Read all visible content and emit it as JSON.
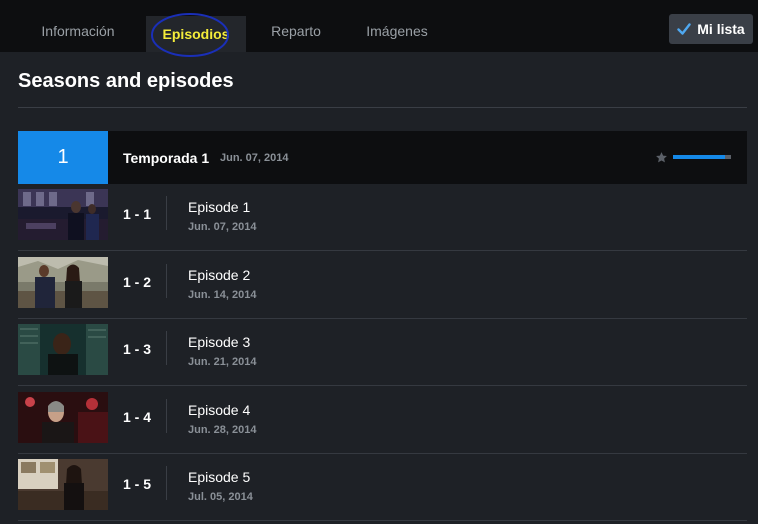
{
  "tabs": [
    {
      "label": "Información",
      "active": false
    },
    {
      "label": "Episodios",
      "active": true
    },
    {
      "label": "Reparto",
      "active": false
    },
    {
      "label": "Imágenes",
      "active": false
    }
  ],
  "my_list": {
    "label": "Mi lista",
    "icon": "check-icon"
  },
  "section_title": "Seasons and episodes",
  "season": {
    "number": "1",
    "title": "Temporada 1",
    "date": "Jun. 07, 2014",
    "progress": 0.9
  },
  "episodes": [
    {
      "code": "1 - 1",
      "title": "Episode 1",
      "date": "Jun. 07, 2014"
    },
    {
      "code": "1 - 2",
      "title": "Episode 2",
      "date": "Jun. 14, 2014"
    },
    {
      "code": "1 - 3",
      "title": "Episode 3",
      "date": "Jun. 21, 2014"
    },
    {
      "code": "1 - 4",
      "title": "Episode 4",
      "date": "Jun. 28, 2014"
    },
    {
      "code": "1 - 5",
      "title": "Episode 5",
      "date": "Jul. 05, 2014"
    }
  ],
  "colors": {
    "accent": "#1589e8",
    "active_tab": "#f4ec3a",
    "annotation_circle": "#1a2fb8"
  }
}
